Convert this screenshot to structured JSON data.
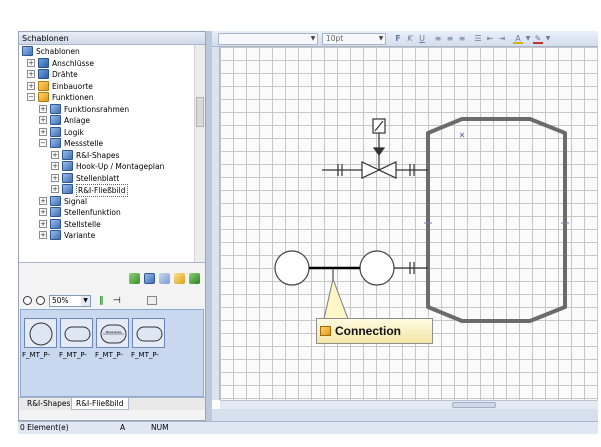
{
  "panel": {
    "title": "Schablonen",
    "tree": [
      {
        "label": "Schablonen",
        "expanded": true
      },
      {
        "label": "Anschlüsse",
        "expanded": false
      },
      {
        "label": "Drähte",
        "expanded": false
      },
      {
        "label": "Einbauorte",
        "expanded": false
      },
      {
        "label": "Funktionen",
        "expanded": true
      },
      {
        "label": "Funktionsrahmen",
        "expanded": false
      },
      {
        "label": "Anlage",
        "expanded": false
      },
      {
        "label": "Logik",
        "expanded": false
      },
      {
        "label": "Messstelle",
        "expanded": true
      },
      {
        "label": "R&I-Shapes",
        "expanded": false
      },
      {
        "label": "Hook-Up / Montageplan",
        "expanded": false
      },
      {
        "label": "Stellenblatt",
        "expanded": false
      },
      {
        "label": "R&I-Fließbild",
        "expanded": false,
        "selected": true
      },
      {
        "label": "Signal",
        "expanded": false
      },
      {
        "label": "Stellenfunktion",
        "expanded": false
      },
      {
        "label": "Stellstelle",
        "expanded": false
      },
      {
        "label": "Variante",
        "expanded": false
      }
    ],
    "zoom": "50%",
    "shapes": [
      {
        "label": "F_MT_P-"
      },
      {
        "label": "F_MT_P-"
      },
      {
        "label": "F_MT_P-"
      },
      {
        "label": "F_MT_P-"
      }
    ],
    "shape3_caption": "Messstelle",
    "tabs": [
      {
        "label": "R&I-Shapes",
        "active": false
      },
      {
        "label": "R&I-Fließbild",
        "active": true
      }
    ]
  },
  "status": {
    "elements": "0 Element(e)",
    "mode": "A",
    "num": "NUM"
  },
  "toolbar": {
    "font_size": "10pt",
    "icons": [
      "bold-icon",
      "italic-icon",
      "underline-icon",
      "align-left-icon",
      "align-center-icon",
      "align-right-icon",
      "list-icon",
      "outdent-icon",
      "indent-icon",
      "font-color-icon",
      "fill-color-icon"
    ]
  },
  "canvas": {
    "callout": "Connection"
  },
  "colors": {
    "accent": "#c9d7ef",
    "diagram_stroke": "#6b6b6b",
    "callout_bg": "#fff6c8"
  }
}
